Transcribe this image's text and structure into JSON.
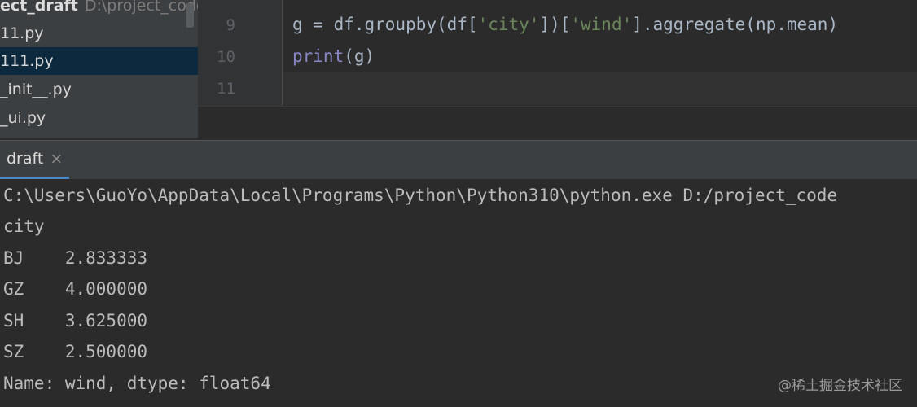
{
  "project": {
    "root_name": "ect_draft",
    "root_path": "D:\\project_code",
    "items": [
      {
        "label": "11.py",
        "selected": false
      },
      {
        "label": "111.py",
        "selected": true
      },
      {
        "label": "_init__.py",
        "selected": false
      },
      {
        "label": "_ui.py",
        "selected": false
      }
    ]
  },
  "editor": {
    "lines": [
      {
        "num": "9",
        "segments": [
          {
            "t": "g = df.groupby(df[",
            "c": ""
          },
          {
            "t": "'city'",
            "c": "str"
          },
          {
            "t": "])[",
            "c": ""
          },
          {
            "t": "'wind'",
            "c": "str"
          },
          {
            "t": "].aggregate(np.mean)",
            "c": ""
          }
        ]
      },
      {
        "num": "10",
        "segments": [
          {
            "t": "print",
            "c": "bi"
          },
          {
            "t": "(g)",
            "c": ""
          }
        ]
      },
      {
        "num": "11",
        "segments": []
      }
    ]
  },
  "run": {
    "tab_label": "draft",
    "close_glyph": "×",
    "output": [
      "C:\\Users\\GuoYo\\AppData\\Local\\Programs\\Python\\Python310\\python.exe D:/project_code",
      "city",
      "BJ    2.833333",
      "GZ    4.000000",
      "SH    3.625000",
      "SZ    2.500000",
      "Name: wind, dtype: float64"
    ]
  },
  "watermark": "@稀土掘金技术社区",
  "colors": {
    "editor_bg": "#2b2b2b",
    "panel_bg": "#3c3f41",
    "selection": "#0d293e",
    "string": "#6a8759",
    "builtin": "#8888c6",
    "accent": "#4a88c7"
  }
}
